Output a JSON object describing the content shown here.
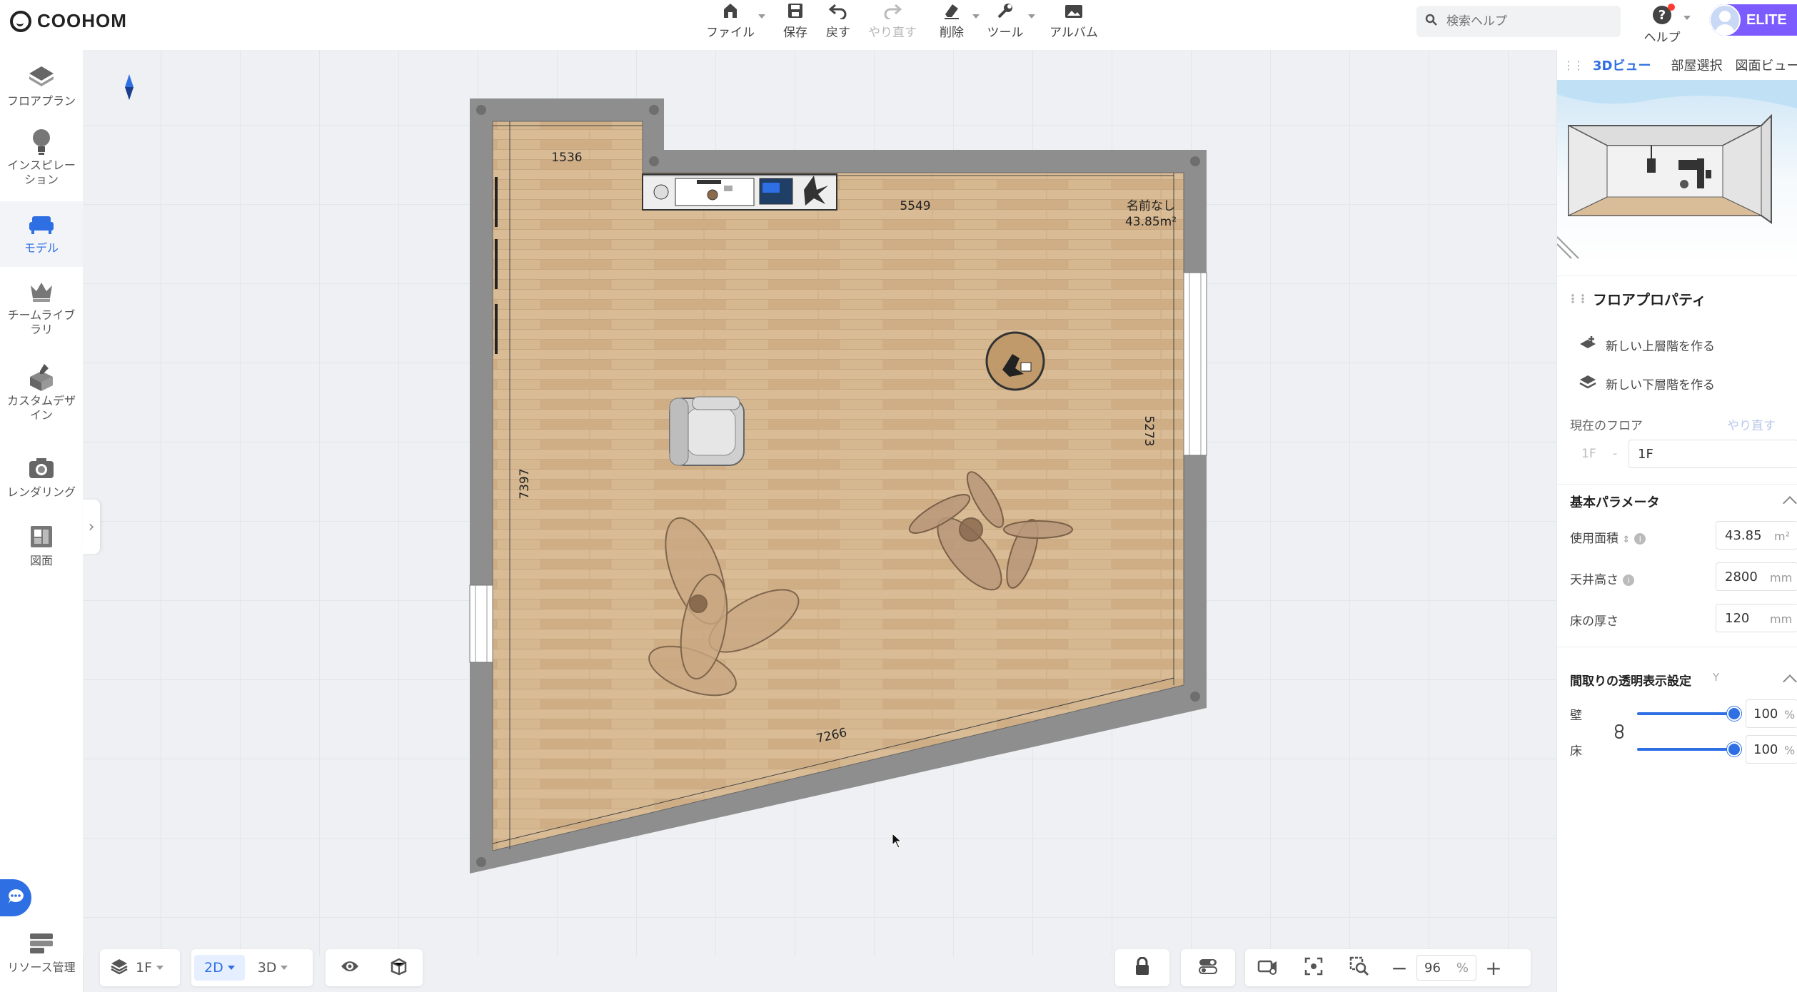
{
  "app": {
    "logo_text": "COOHOM"
  },
  "toolbar": {
    "file": "ファイル",
    "save": "保存",
    "undo": "戻す",
    "redo": "やり直す",
    "delete": "削除",
    "tools": "ツール",
    "album": "アルバム"
  },
  "search": {
    "placeholder": "検索ヘルプ"
  },
  "help": {
    "label": "ヘルプ",
    "icon": "?"
  },
  "account": {
    "badge": "ELITE"
  },
  "sidebar": {
    "items": [
      {
        "label": "フロアプラン",
        "icon": "floorplan-icon"
      },
      {
        "label": "インスピレーション",
        "icon": "lightbulb-icon"
      },
      {
        "label": "モデル",
        "icon": "sofa-icon",
        "active": true
      },
      {
        "label": "チームライブラリ",
        "icon": "crown-icon"
      },
      {
        "label": "カスタムデザイン",
        "icon": "custom-design-icon"
      },
      {
        "label": "レンダリング",
        "icon": "camera-icon"
      },
      {
        "label": "図面",
        "icon": "drawing-icon"
      }
    ],
    "resource": "リソース管理",
    "collapse_glyph": "›"
  },
  "plan": {
    "room_name": "名前なし",
    "room_area": "43.85m²",
    "dimensions": {
      "top_left": "1536",
      "top": "5549",
      "right": "5273",
      "left": "7397",
      "bottom": "7266"
    }
  },
  "bottombar": {
    "floor": "1F",
    "view_2d": "2D",
    "view_3d": "3D",
    "zoom_value": "96",
    "zoom_unit": "%",
    "zoom_minus": "−",
    "zoom_plus": "+"
  },
  "rightpanel": {
    "tabs": [
      "3Dビュー",
      "部屋選択",
      "図面ビュー"
    ],
    "floor_properties": {
      "title": "フロアプロパティ",
      "new_upper": "新しい上層階を作る",
      "new_lower": "新しい下層階を作る",
      "current_floor_label": "現在のフロア",
      "redo": "やり直す",
      "floor_from": "1F",
      "floor_sep": "-",
      "floor_value": "1F"
    },
    "basic_params": {
      "title": "基本パラメータ",
      "area_label": "使用面積",
      "area_value": "43.85",
      "area_unit": "m²",
      "ceiling_label": "天井高さ",
      "ceiling_value": "2800",
      "ceiling_unit": "mm",
      "floor_thickness_label": "床の厚さ",
      "floor_thickness_value": "120",
      "floor_thickness_unit": "mm"
    },
    "transparency": {
      "title": "間取りの透明表示設定",
      "hint": "Y",
      "wall_label": "壁",
      "wall_value": "100",
      "wall_unit": "%",
      "wall_level_pct": 100,
      "floor_label": "床",
      "floor_value": "100",
      "floor_unit": "%",
      "floor_level_pct": 100
    }
  },
  "colors": {
    "accent": "#2f6fe4",
    "elite": "#7c5cff",
    "wall": "#8e8e8e",
    "floor_wood": "#d2b38c"
  }
}
